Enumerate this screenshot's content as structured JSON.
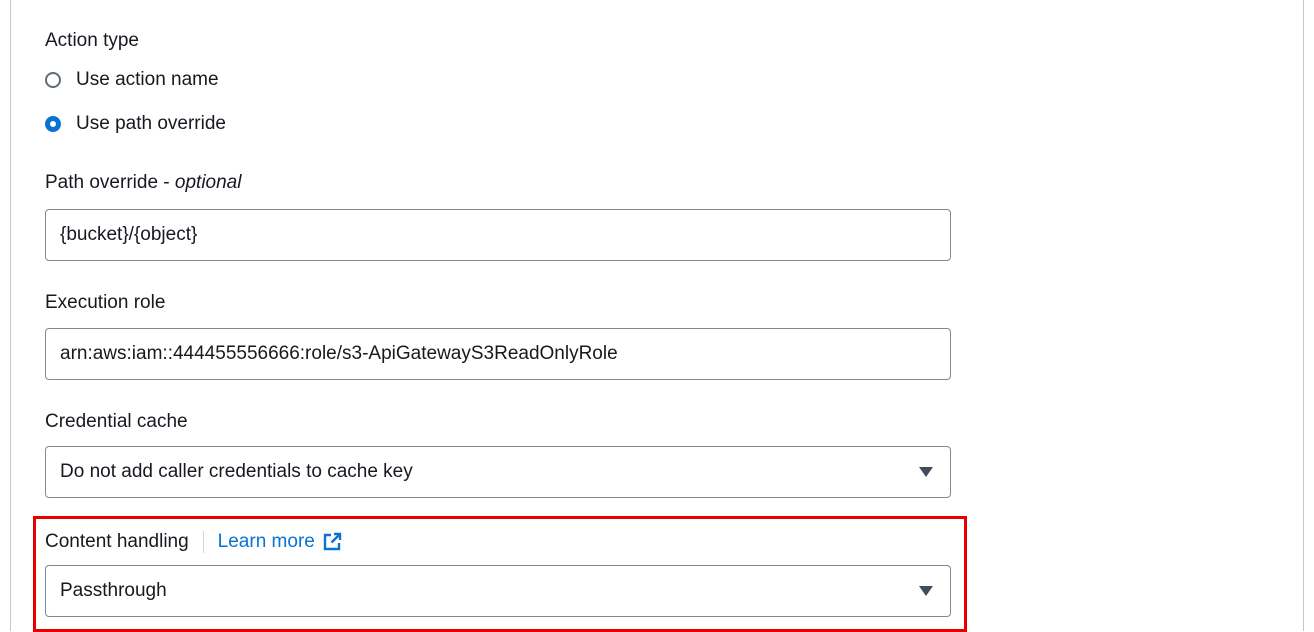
{
  "action_type": {
    "label": "Action type",
    "options": [
      {
        "label": "Use action name",
        "selected": false
      },
      {
        "label": "Use path override",
        "selected": true
      }
    ]
  },
  "path_override": {
    "label": "Path override - ",
    "label_suffix": "optional",
    "value": "{bucket}/{object}"
  },
  "execution_role": {
    "label": "Execution role",
    "value": "arn:aws:iam::444455556666:role/s3-ApiGatewayS3ReadOnlyRole"
  },
  "credential_cache": {
    "label": "Credential cache",
    "selected": "Do not add caller credentials to cache key"
  },
  "content_handling": {
    "label": "Content handling",
    "learn_more": "Learn more",
    "selected": "Passthrough"
  },
  "colors": {
    "accent": "#0972d3",
    "highlight": "#e60000",
    "text": "#16191f"
  }
}
